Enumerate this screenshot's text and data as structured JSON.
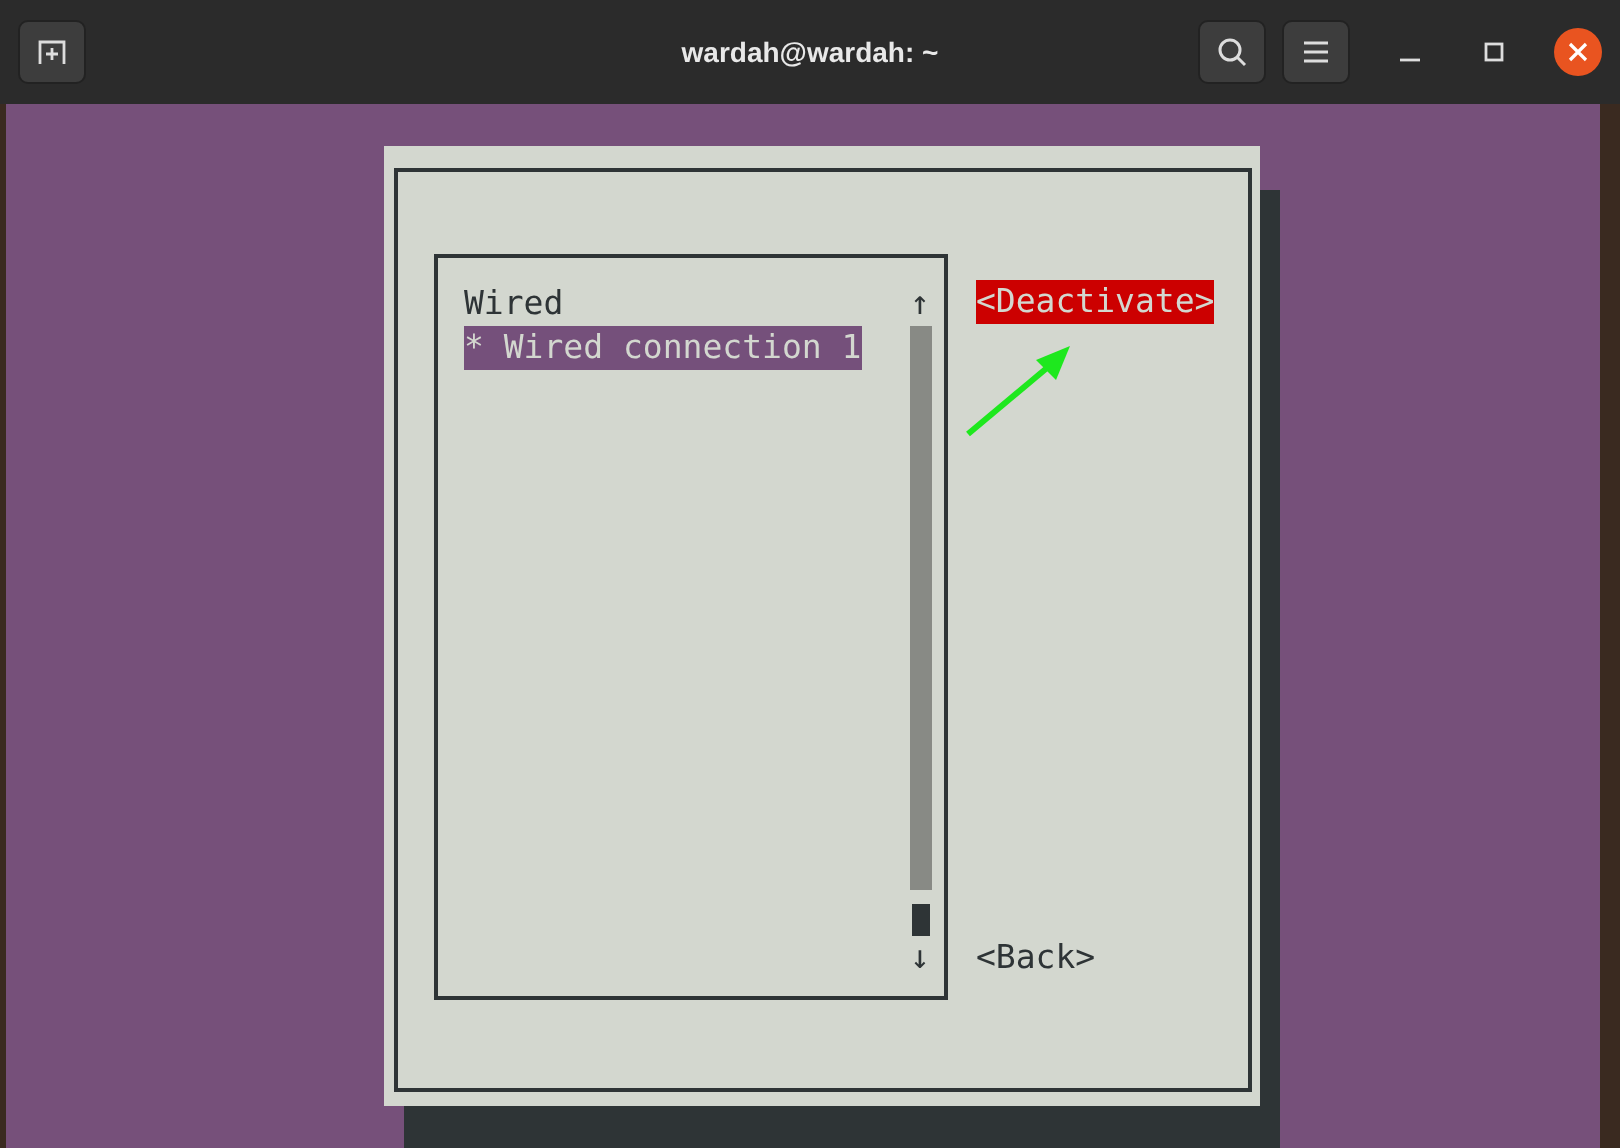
{
  "window": {
    "title": "wardah@wardah: ~"
  },
  "list": {
    "group": "Wired",
    "items": [
      {
        "label": "* Wired connection 1",
        "selected": true
      }
    ],
    "scroll_up": "↑",
    "scroll_down": "↓"
  },
  "buttons": [
    {
      "label": "<Deactivate>",
      "selected": true
    },
    {
      "label": "<Back>",
      "selected": false
    }
  ]
}
